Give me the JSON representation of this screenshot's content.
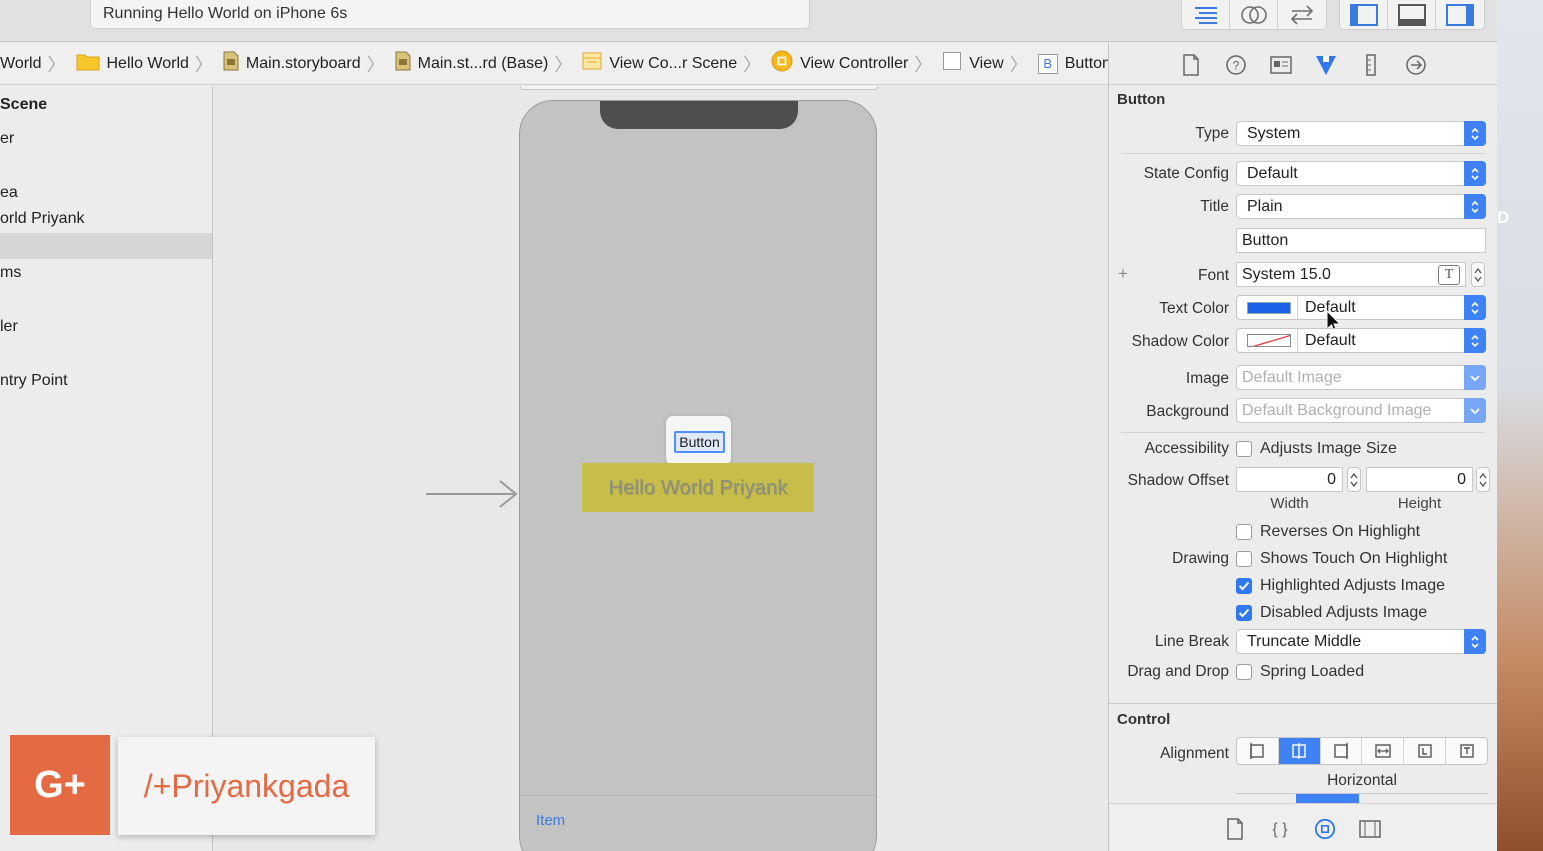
{
  "toolbar": {
    "activity_text": "Running Hello World on iPhone 6s",
    "editor_buttons": [
      "standard-editor-icon",
      "assistant-editor-icon",
      "version-editor-icon"
    ],
    "view_buttons": [
      "navigator-toggle-icon",
      "debug-area-toggle-icon",
      "utilities-toggle-icon"
    ]
  },
  "jumpbar": {
    "crumbs": [
      "World",
      "Hello World",
      "Main.storyboard",
      "Main.st...rd (Base)",
      "View Co...r Scene",
      "View Controller",
      "View",
      "Button"
    ],
    "button_glyph": "B"
  },
  "outline": {
    "rows": [
      "Scene",
      "er",
      "ea",
      "orld Priyank",
      "ms",
      "ler",
      "ntry Point"
    ]
  },
  "canvas": {
    "button_label": "Button",
    "label_text": "Hello World Priyank",
    "tab_item": "Item"
  },
  "inspector": {
    "section_button": "Button",
    "type_label": "Type",
    "type_value": "System",
    "state_config_label": "State Config",
    "state_config_value": "Default",
    "title_label": "Title",
    "title_value": "Plain",
    "title_text": "Button",
    "font_label": "Font",
    "font_value": "System 15.0",
    "font_glyph": "T",
    "text_color_label": "Text Color",
    "text_color_value": "Default",
    "text_color_swatch": "#1c62e8",
    "shadow_color_label": "Shadow Color",
    "shadow_color_value": "Default",
    "image_label": "Image",
    "image_placeholder": "Default Image",
    "background_label": "Background",
    "background_placeholder": "Default Background Image",
    "accessibility_label": "Accessibility",
    "adjusts_image_size": "Adjusts Image Size",
    "shadow_offset_label": "Shadow Offset",
    "shadow_width": "0",
    "shadow_height": "0",
    "width_caption": "Width",
    "height_caption": "Height",
    "drawing_label": "Drawing",
    "reverses_on_highlight": "Reverses On Highlight",
    "shows_touch_on_highlight": "Shows Touch On Highlight",
    "highlighted_adjusts_image": "Highlighted Adjusts Image",
    "disabled_adjusts_image": "Disabled Adjusts Image",
    "line_break_label": "Line Break",
    "line_break_value": "Truncate Middle",
    "drag_drop_label": "Drag and Drop",
    "spring_loaded": "Spring Loaded",
    "section_control": "Control",
    "alignment_label": "Alignment",
    "horizontal_caption": "Horizontal",
    "plus_glyph": "+"
  },
  "overlay": {
    "gplus_logo": "G+",
    "handle": "/+Priyankgada"
  },
  "desktop": {
    "letter": "D"
  },
  "colors": {
    "accent": "#3f82f6",
    "label_bg": "#c6be48",
    "gplus": "#e46a43"
  }
}
